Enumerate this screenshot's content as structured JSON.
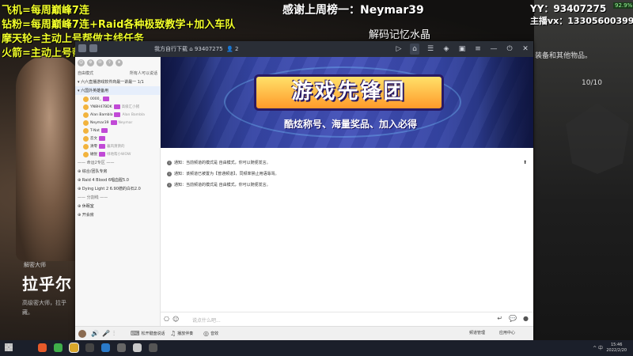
{
  "overlay": {
    "promos": [
      "飞机=每周巅峰7连",
      "钻粉=每周巅峰7连+Raid各种极致教学+加入车队",
      "摩天轮=主动上号帮做主线任务",
      "火箭=主动上号帮做主线任务+一周巅峰球"
    ],
    "thanks": "感谢上周榜一：Neymar39",
    "subtitle": "解码记忆水晶",
    "yy": "YY：93407275",
    "vx": "主播vx：13305600399",
    "pct": "92.9%"
  },
  "game": {
    "right_text": "装备和其他物品。",
    "counter": "10/10",
    "left_tag": "解密大师",
    "left_title": "拉乎尔",
    "left_desc1": "高级密大师，拉乎",
    "left_desc2": "藏。"
  },
  "window": {
    "title": "我方自行下载",
    "channel_id": "93407275",
    "viewers": "2",
    "left": {
      "mode": "自由模式",
      "mode_right": "所有人可以说话",
      "room": "六六直播游戏软件商最一讲最一",
      "room_count": "1/1",
      "channel": "六国外英雄备用",
      "users": [
        {
          "name": "0000_",
          "sig": ""
        },
        {
          "name": "YN8H47BDK",
          "sig": "高级汇小猪"
        },
        {
          "name": "Alan Bambla",
          "sig": "Alan Bambla"
        },
        {
          "name": "Neymar39",
          "sig": "Neymar"
        },
        {
          "name": "T-Nat",
          "sig": ""
        },
        {
          "name": "恋文",
          "sig": ""
        },
        {
          "name": "清零",
          "sig": "暮风萧萧的"
        },
        {
          "name": "磁悦",
          "sig": "绿地帮小WOW"
        }
      ],
      "sep1": "—— 命运2专区 ——",
      "channels2": [
        "综合/团队专房",
        "Raid 4 Blood 6唱血腥5.0",
        "Dying Light 2 6.90德的白石2.0"
      ],
      "sep2": "—— 分割线 ——",
      "channels3": [
        "休眠室",
        "开会房"
      ]
    },
    "banner": {
      "title": "游戏先锋团",
      "subtitle": "酷炫称号、海量奖品、加入必得"
    },
    "notices": [
      "通知：当前频道的模式是 自由模式，你可以随便发言。",
      "通知：该频道已被置为【普通频道】，同频率禁止用语辱骂。",
      "通知：当前频道的模式是 自由模式，你可以随便发言。"
    ],
    "input_placeholder": "说点什么吧...",
    "bottom": {
      "open_mic": "松开键盘说话",
      "play_music": "播放伴奏",
      "effect": "音效",
      "stage": "频道管理",
      "app_center": "应用中心"
    }
  },
  "taskbar": {
    "tray": "^ 中",
    "time": "15:46",
    "date": "2022/2/20"
  },
  "colors": {
    "promo_yellow": "#f2ff2a",
    "titlebar": "#2a2e36",
    "banner_blue": "#3545a5"
  }
}
